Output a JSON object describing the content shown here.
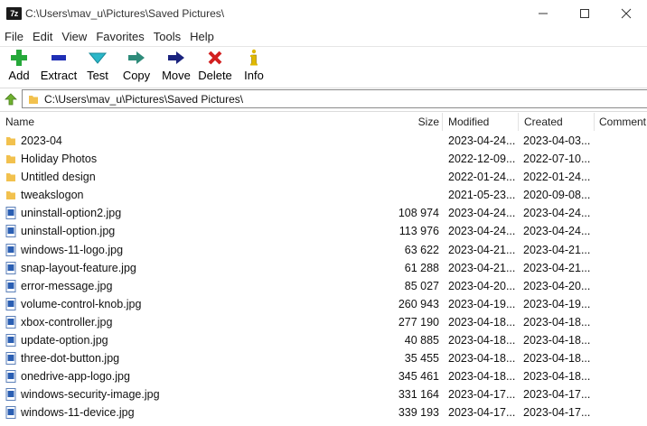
{
  "window": {
    "title": "C:\\Users\\mav_u\\Pictures\\Saved Pictures\\",
    "app_icon": "7z"
  },
  "menu": [
    "File",
    "Edit",
    "View",
    "Favorites",
    "Tools",
    "Help"
  ],
  "toolbar": {
    "add": "Add",
    "extract": "Extract",
    "test": "Test",
    "copy": "Copy",
    "move": "Move",
    "delete": "Delete",
    "info": "Info"
  },
  "address": {
    "path": "C:\\Users\\mav_u\\Pictures\\Saved Pictures\\"
  },
  "columns": {
    "name": "Name",
    "size": "Size",
    "modified": "Modified",
    "created": "Created",
    "comment": "Comment"
  },
  "rows": [
    {
      "type": "folder",
      "name": "2023-04",
      "size": "",
      "modified": "2023-04-24...",
      "created": "2023-04-03..."
    },
    {
      "type": "folder",
      "name": "Holiday Photos",
      "size": "",
      "modified": "2022-12-09...",
      "created": "2022-07-10..."
    },
    {
      "type": "folder",
      "name": "Untitled design",
      "size": "",
      "modified": "2022-01-24...",
      "created": "2022-01-24..."
    },
    {
      "type": "folder",
      "name": "tweakslogon",
      "size": "",
      "modified": "2021-05-23...",
      "created": "2020-09-08..."
    },
    {
      "type": "image",
      "name": "uninstall-option2.jpg",
      "size": "108 974",
      "modified": "2023-04-24...",
      "created": "2023-04-24..."
    },
    {
      "type": "image",
      "name": "uninstall-option.jpg",
      "size": "113 976",
      "modified": "2023-04-24...",
      "created": "2023-04-24..."
    },
    {
      "type": "image",
      "name": "windows-11-logo.jpg",
      "size": "63 622",
      "modified": "2023-04-21...",
      "created": "2023-04-21..."
    },
    {
      "type": "image",
      "name": "snap-layout-feature.jpg",
      "size": "61 288",
      "modified": "2023-04-21...",
      "created": "2023-04-21..."
    },
    {
      "type": "image",
      "name": "error-message.jpg",
      "size": "85 027",
      "modified": "2023-04-20...",
      "created": "2023-04-20..."
    },
    {
      "type": "image",
      "name": "volume-control-knob.jpg",
      "size": "260 943",
      "modified": "2023-04-19...",
      "created": "2023-04-19..."
    },
    {
      "type": "image",
      "name": "xbox-controller.jpg",
      "size": "277 190",
      "modified": "2023-04-18...",
      "created": "2023-04-18..."
    },
    {
      "type": "image",
      "name": "update-option.jpg",
      "size": "40 885",
      "modified": "2023-04-18...",
      "created": "2023-04-18..."
    },
    {
      "type": "image",
      "name": "three-dot-button.jpg",
      "size": "35 455",
      "modified": "2023-04-18...",
      "created": "2023-04-18..."
    },
    {
      "type": "image",
      "name": "onedrive-app-logo.jpg",
      "size": "345 461",
      "modified": "2023-04-18...",
      "created": "2023-04-18..."
    },
    {
      "type": "image",
      "name": "windows-security-image.jpg",
      "size": "331 164",
      "modified": "2023-04-17...",
      "created": "2023-04-17..."
    },
    {
      "type": "image",
      "name": "windows-11-device.jpg",
      "size": "339 193",
      "modified": "2023-04-17...",
      "created": "2023-04-17..."
    }
  ],
  "colors": {
    "folder": "#f2c14e",
    "image_icon": "#2b5fb3",
    "add": "#25a83a",
    "extract": "#1f2fb5",
    "test": "#2bb7c9",
    "copy": "#2e8b7a",
    "move": "#1a237e",
    "delete": "#d21f1f",
    "info": "#e0b800"
  }
}
